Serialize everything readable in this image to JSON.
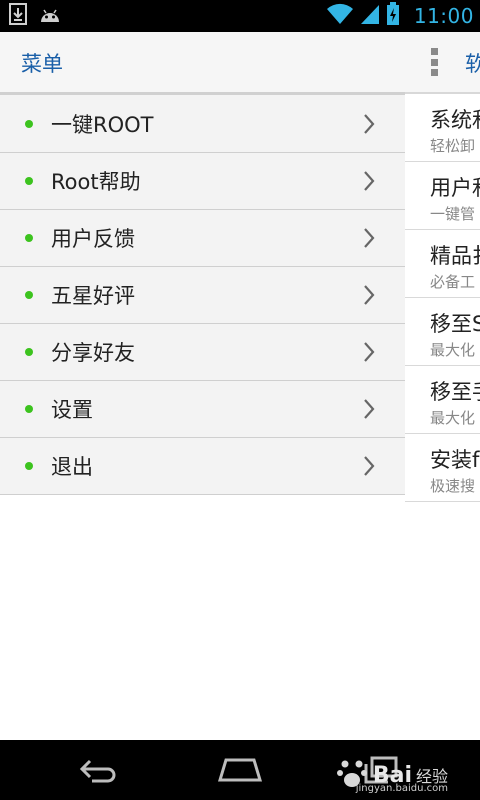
{
  "status_bar": {
    "time": "11:00",
    "icons": [
      "download-icon",
      "android-icon",
      "wifi-icon",
      "signal-icon",
      "battery-icon"
    ],
    "accent_color": "#33b5e5"
  },
  "drawer": {
    "title": "菜单",
    "items": [
      {
        "label": "一键ROOT"
      },
      {
        "label": "Root帮助"
      },
      {
        "label": "用户反馈"
      },
      {
        "label": "五星好评"
      },
      {
        "label": "分享好友"
      },
      {
        "label": "设置"
      },
      {
        "label": "退出"
      }
    ],
    "dot_color": "#3cc31e",
    "title_color": "#1a5fa8"
  },
  "content": {
    "title": "软",
    "items": [
      {
        "title": "系统和",
        "subtitle": "轻松卸"
      },
      {
        "title": "用户和",
        "subtitle": "一键管"
      },
      {
        "title": "精品扌",
        "subtitle": "必备工"
      },
      {
        "title": "移至S",
        "subtitle": "最大化"
      },
      {
        "title": "移至手",
        "subtitle": "最大化"
      },
      {
        "title": "安装f",
        "subtitle": "极速搜"
      }
    ]
  },
  "nav_bar": {
    "buttons": [
      "back-icon",
      "home-icon",
      "recent-apps-icon"
    ]
  },
  "watermark": {
    "brand": "Bai",
    "brand_suffix": "经验",
    "url": "jingyan.baidu.com"
  }
}
